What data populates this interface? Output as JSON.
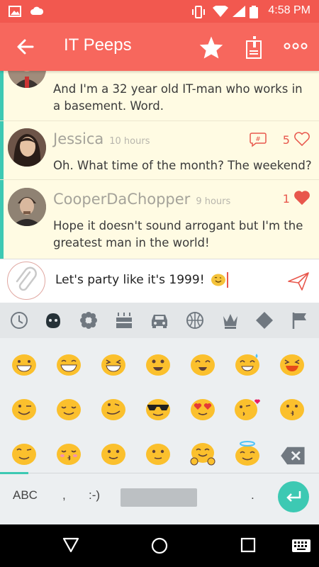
{
  "status_bar": {
    "time": "4:58 PM",
    "icons": [
      "image-icon",
      "cloud-icon",
      "vibrate-icon",
      "wifi-icon",
      "signal-icon",
      "battery-icon"
    ]
  },
  "app_bar": {
    "title": "IT Peeps",
    "icons": [
      "back-arrow-icon",
      "star-icon",
      "info-document-icon",
      "more-options-icon"
    ]
  },
  "messages": [
    {
      "author": "",
      "time": "",
      "text": "And I'm a 32 year old IT-man who works in a basement. Word.",
      "likes": ""
    },
    {
      "author": "Jessica",
      "time": "10 hours",
      "text": "Oh. What time of the month? The weekend?",
      "likes": "5",
      "liked": false
    },
    {
      "author": "CooperDaChopper",
      "time": "9 hours",
      "text": "Hope it doesn't sound arrogant but I'm the greatest man in the world!",
      "likes": "1",
      "liked": true
    }
  ],
  "composer": {
    "text": "Let's party like it's 1999!",
    "icons": [
      "paperclip-icon",
      "send-icon"
    ]
  },
  "keyboard": {
    "categories": [
      "recent-icon",
      "emoji-face-icon",
      "flower-icon",
      "cake-icon",
      "car-icon",
      "ball-icon",
      "crown-icon",
      "diamond-icon",
      "flag-icon"
    ],
    "bottom_keys": {
      "abc": "ABC",
      "comma": ",",
      "smiley": ":-)",
      "period": "."
    }
  },
  "colors": {
    "primary": "#f7675d",
    "status": "#f2584f",
    "accent": "#3dc9b3",
    "background": "#fffbe3"
  }
}
